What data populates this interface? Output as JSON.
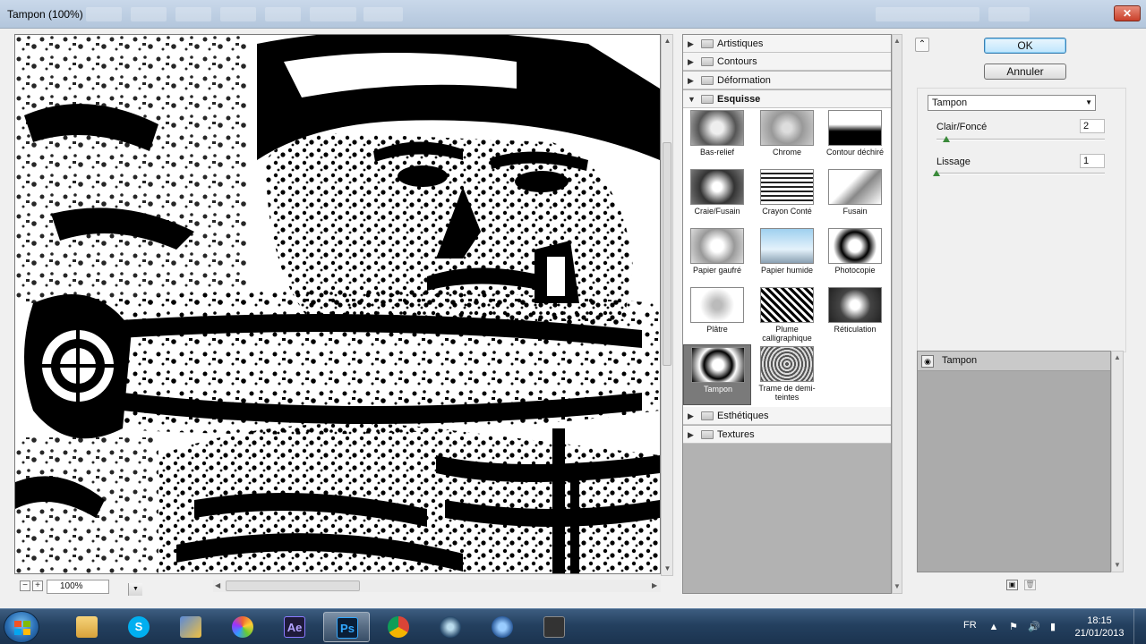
{
  "window": {
    "title": "Tampon (100%)"
  },
  "preview": {
    "zoom": "100%"
  },
  "filters": {
    "folders": [
      {
        "label": "Artistiques",
        "open": false
      },
      {
        "label": "Contours",
        "open": false
      },
      {
        "label": "Déformation",
        "open": false
      },
      {
        "label": "Esquisse",
        "open": true
      }
    ],
    "esquisse_items": [
      "Bas-relief",
      "Chrome",
      "Contour déchiré",
      "Craie/Fusain",
      "Crayon Conté",
      "Fusain",
      "Papier gaufré",
      "Papier humide",
      "Photocopie",
      "Plâtre",
      "Plume calligraphique",
      "Réticulation",
      "Tampon",
      "Trame de demi-teintes"
    ],
    "selected": "Tampon",
    "folders_after": [
      {
        "label": "Esthétiques",
        "open": false
      },
      {
        "label": "Textures",
        "open": false
      }
    ]
  },
  "buttons": {
    "ok": "OK",
    "cancel": "Annuler"
  },
  "settings": {
    "filter_select": "Tampon",
    "params": [
      {
        "label": "Clair/Foncé",
        "value": "2",
        "level": 0.06
      },
      {
        "label": "Lissage",
        "value": "1",
        "level": 0.0
      }
    ]
  },
  "layers": [
    {
      "name": "Tampon",
      "visible": true
    }
  ],
  "taskbar": {
    "apps": [
      {
        "icon": "explorer-icon",
        "label": ""
      },
      {
        "icon": "skype-icon",
        "label": ""
      },
      {
        "icon": "paint-icon",
        "label": ""
      },
      {
        "icon": "picasa-icon",
        "label": ""
      },
      {
        "icon": "after-effects-icon",
        "label": "Ae"
      },
      {
        "icon": "photoshop-icon",
        "label": "Ps"
      },
      {
        "icon": "chrome-icon",
        "label": ""
      },
      {
        "icon": "media-player-icon",
        "label": ""
      },
      {
        "icon": "settings-icon",
        "label": ""
      },
      {
        "icon": "video-app-icon",
        "label": ""
      }
    ],
    "language": "FR",
    "time": "18:15",
    "date": "21/01/2013"
  },
  "colors": {
    "accent": "#3c7fb1",
    "taskbar": "#24405f",
    "tree_bg": "#b2b2b2"
  }
}
